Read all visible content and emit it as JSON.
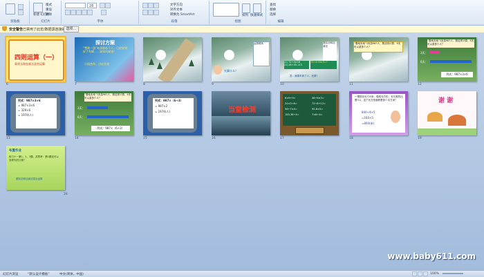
{
  "ribbon": {
    "groups": [
      "剪贴板",
      "幻灯片",
      "字体",
      "段落",
      "绘图",
      "编辑"
    ],
    "buttons": {
      "new_slide": "新建\n幻灯片",
      "layout": "版式",
      "reset": "重设",
      "delete": "删除",
      "font_size": "28",
      "text_direction": "文字方向",
      "align_text": "对齐文本",
      "smartart": "转换为 SmartArt",
      "arrange": "排列",
      "quick_styles": "快速样式",
      "find": "查找",
      "replace": "替换",
      "select": "选择"
    }
  },
  "security": {
    "title": "安全警告",
    "message": "已禁用了此宏/数据源连接的部分内容",
    "options_button": "选项..."
  },
  "slides": [
    {
      "num": "6",
      "title": "四则运算（一）",
      "sub": "乘除法和加减法混合运算"
    },
    {
      "num": "7",
      "title": "探讨方案",
      "text": "“雪地一游”有游客若干人，已经安排好了车辆……该如何安排？",
      "foot": "小组合作，讨论交流"
    },
    {
      "num": "8"
    },
    {
      "num": "9",
      "text": "运算顺序",
      "bubble": "先算什么？"
    },
    {
      "num": "10",
      "text": "乘除法和加减法",
      "eq1": "(1) 72÷4×18",
      "eq2": "(2) 28+35-113",
      "eq3": "72÷4+6×5=?",
      "foot": "答：我乘车到了人，还乘？"
    },
    {
      "num": "11",
      "text": "“雪地天地”3天游987人，乘法则计算，6天可以游多少人？"
    },
    {
      "num": "12",
      "head": "“雪地天地”3天游987人，照这样计算，6天可以游多少人？",
      "row1": "3天：",
      "row2": "6天：",
      "formula": "列式：987×3×6"
    },
    {
      "num": "13",
      "formula": "列式：987×3×6",
      "s1": "= 987×3×6",
      "s2": "= 329×6",
      "s3": "= 1974(人)"
    },
    {
      "num": "14",
      "head": "“雪地天地”3天游987人，照这样计算，6天可以游多少人？",
      "row1": "3天：",
      "row2": "6天：",
      "formula": "列式：987×（6÷3）"
    },
    {
      "num": "15",
      "formula": "列式：987×（6÷3）",
      "s1": "= 987×2",
      "s2": "= 1974(人)"
    },
    {
      "num": "16",
      "title": "当堂检测"
    },
    {
      "num": "17",
      "l1": "6×9+9=",
      "l2": "24×3÷6=",
      "l3": "56÷7×4=",
      "l4": "100-36÷4=",
      "r1": "48÷6×3=",
      "r2": "72÷8+12=",
      "r3": "90-6×5=",
      "r4": "7×8÷4="
    },
    {
      "num": "18",
      "text": "一根铁丝长720米，做成长方形，长与宽的比是3:2，这个长方形面积是多少平方米？",
      "s1": "840÷4×5",
      "s2": "=160×5",
      "s3": "=800(米)"
    },
    {
      "num": "19",
      "title": "谢 谢"
    },
    {
      "num": "20",
      "h": "布置作业",
      "text": "练习十一第1、2、3题，并思考：第1题还可以怎样列式计算？",
      "foot": "乘除法和加减法混合运算"
    }
  ],
  "watermark": "www.baby611.com",
  "statusbar": {
    "view": "幻灯片浏览",
    "theme": "“默认设计模板”",
    "language": "中文(简体，中国)",
    "zoom": "100%"
  }
}
